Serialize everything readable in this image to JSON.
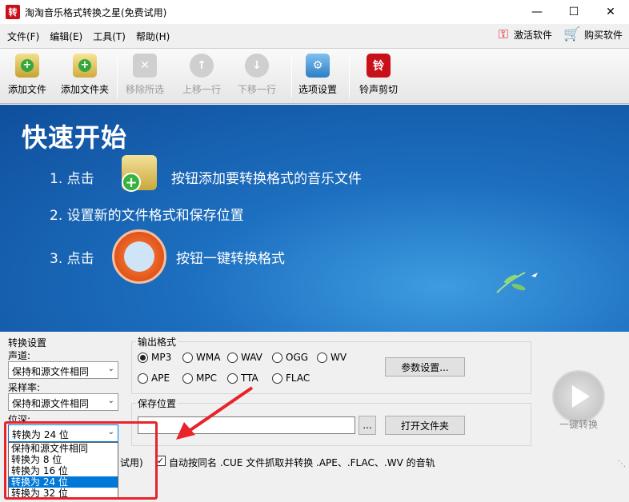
{
  "window": {
    "title": "淘淘音乐格式转换之星(免费试用)",
    "app_icon_char": "转"
  },
  "menu": {
    "items": [
      "文件(F)",
      "编辑(E)",
      "工具(T)",
      "帮助(H)"
    ],
    "activate": "激活软件",
    "buy": "购买软件"
  },
  "toolbar": {
    "add_file": "添加文件",
    "add_folder": "添加文件夹",
    "remove_selected": "移除所选",
    "move_up": "上移一行",
    "move_down": "下移一行",
    "options": "选项设置",
    "ringtone": "铃声剪切",
    "ringtone_icon_char": "铃"
  },
  "banner": {
    "title": "快速开始",
    "step1_prefix": "1. 点击",
    "step1_suffix": "按钮添加要转换格式的音乐文件",
    "step2": "2. 设置新的文件格式和保存位置",
    "step3_prefix": "3. 点击",
    "step3_suffix": "按钮一键转换格式"
  },
  "convert_settings": {
    "title": "转换设置",
    "channel_label": "声道:",
    "channel_value": "保持和源文件相同",
    "samplerate_label": "采样率:",
    "samplerate_value": "保持和源文件相同",
    "bitdepth_label": "位深:",
    "bitdepth_value": "转换为 24 位",
    "bitdepth_options": [
      "保持和源文件相同",
      "转换为 8 位",
      "转换为 16 位",
      "转换为 24 位",
      "转换为 32 位"
    ],
    "bitdepth_selected_index": 3
  },
  "output_format": {
    "title": "输出格式",
    "row1": [
      "MP3",
      "WMA",
      "WAV",
      "OGG",
      "WV"
    ],
    "row2": [
      "APE",
      "MPC",
      "TTA",
      "FLAC"
    ],
    "selected": "MP3",
    "params_button": "参数设置..."
  },
  "save_location": {
    "title": "保存位置",
    "path_value": "",
    "browse_button": "...",
    "open_folder_button": "打开文件夹"
  },
  "one_click": {
    "label": "一键转换"
  },
  "bottom": {
    "trial_fragment": "试用)",
    "auto_cue_text": "自动按同名 .CUE 文件抓取并转换 .APE、.FLAC、.WV 的音轨",
    "auto_cue_checked": true
  },
  "colors": {
    "annotation_red": "#e8232a",
    "selection_blue": "#0078d7"
  }
}
